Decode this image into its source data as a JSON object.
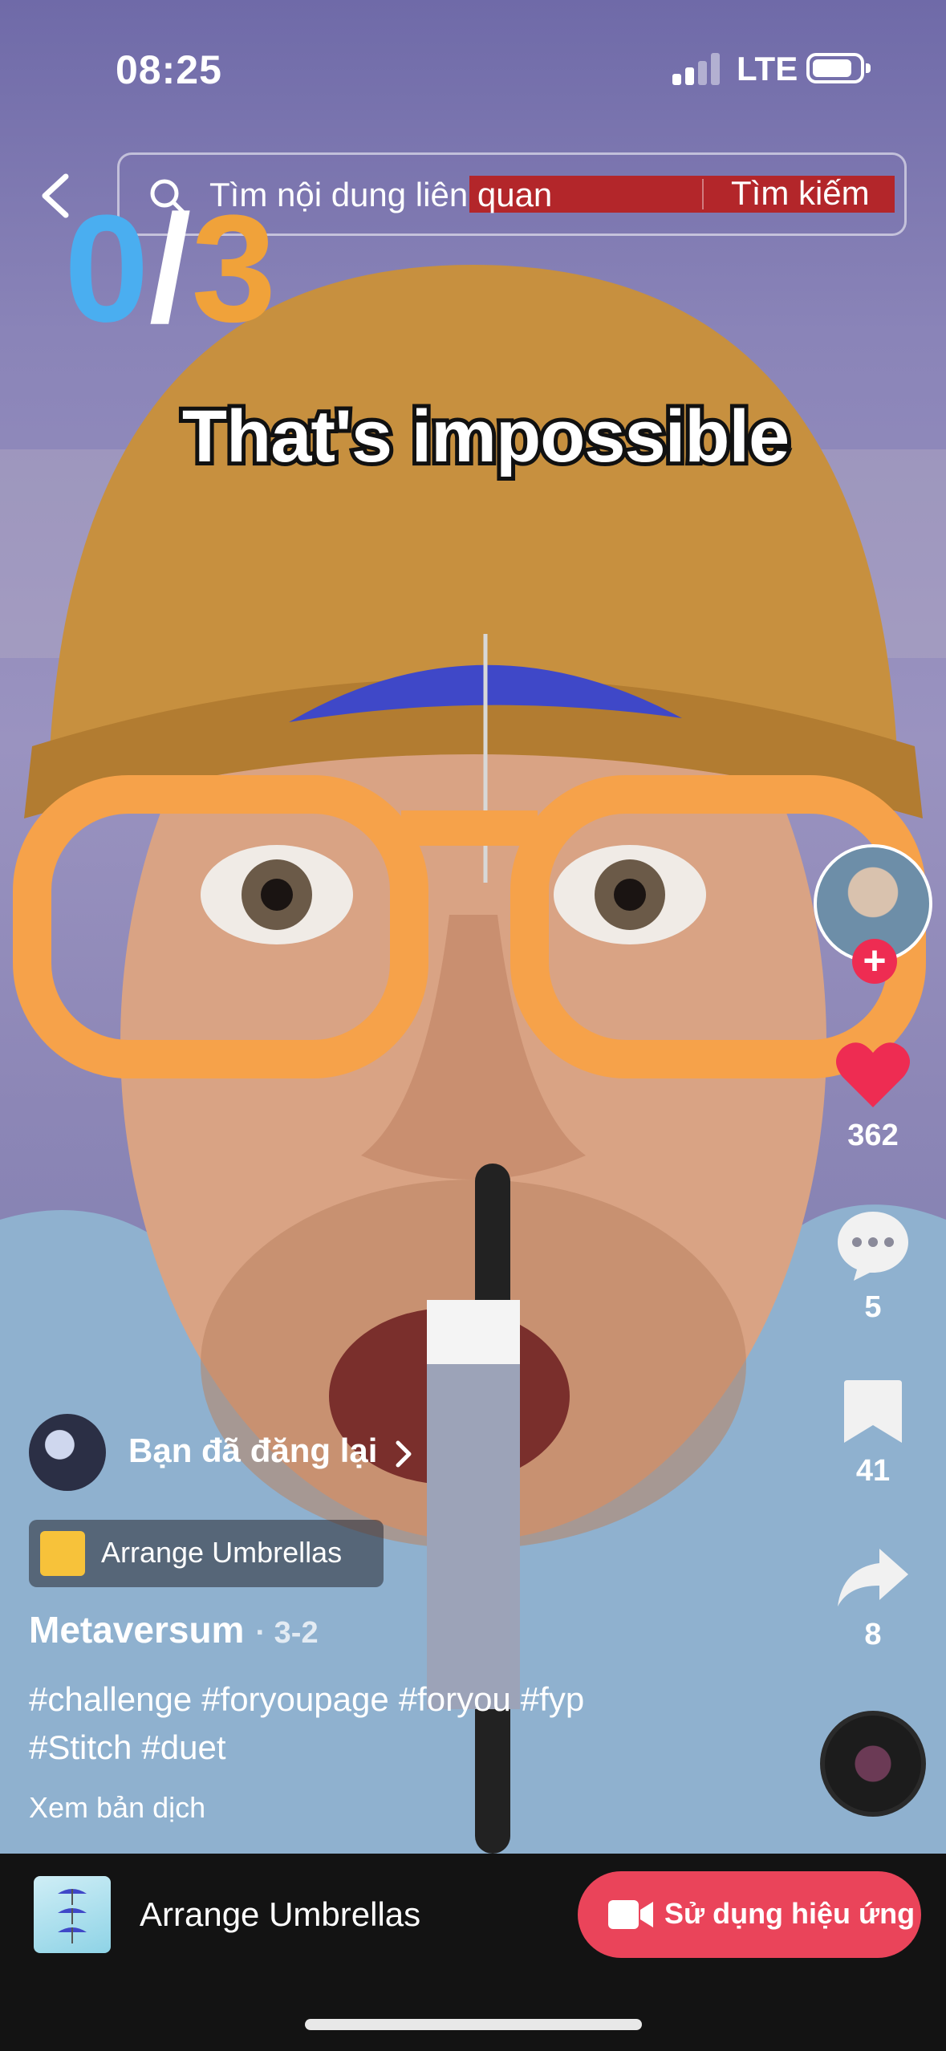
{
  "status_bar": {
    "time": "08:25",
    "network": "LTE"
  },
  "search": {
    "placeholder": "Tìm nội dung liên quan",
    "submit_label": "Tìm kiếm"
  },
  "game_overlay": {
    "score_current": "0",
    "score_separator": "/",
    "score_total": "3",
    "caption": "That's impossible"
  },
  "actions": {
    "likes": "362",
    "comments": "5",
    "saves": "41",
    "shares": "8"
  },
  "follow_symbol": "+",
  "repost": {
    "label": "Bạn đã đăng lại"
  },
  "effect_tag": {
    "label": "Arrange Umbrellas"
  },
  "post": {
    "author": "Metaversum",
    "date": "· 3-2",
    "hashtags": [
      "#challenge",
      "#foryoupage",
      "#foryou",
      "#fyp",
      "#Stitch",
      "#duet"
    ],
    "translate_label": "Xem bản dịch"
  },
  "bottom_bar": {
    "effect_name": "Arrange Umbrellas",
    "use_effect_label": "Sử dụng hiệu ứng"
  },
  "colors": {
    "accent": "#ea445a",
    "like": "#ee2c52",
    "score_blue": "#4aaef0",
    "score_orange": "#f0a23a"
  }
}
